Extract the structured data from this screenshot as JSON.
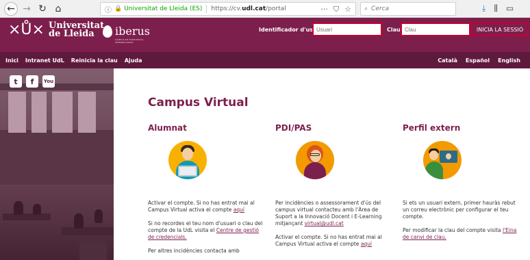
{
  "browser": {
    "url_org": "Universitat de Lleida (ES)",
    "url_text_prefix": "https://cv.",
    "url_text_domain": "udl.cat",
    "url_text_suffix": "/portal",
    "search_placeholder": "Cerca",
    "menu_dots": "···"
  },
  "header": {
    "university_line1": "Universitat",
    "university_line2": "de Lleida",
    "partner": "iberus",
    "partner_sub": "CAMPUS DE EXCELENCIA INTERNACIONAL",
    "login": {
      "user_label": "Identificador d'usuari",
      "user_placeholder": "Usuari",
      "pass_label": "Clau:",
      "pass_placeholder": "Clau",
      "submit_label": "INICIA LA SESSIÓ"
    }
  },
  "nav": {
    "left": [
      "Inici",
      "Intranet UdL",
      "Reinicia la clau",
      "Ajuda"
    ],
    "right": [
      "Català",
      "Español",
      "English"
    ]
  },
  "social": [
    "twitter-icon",
    "facebook-icon",
    "youtube-icon"
  ],
  "main": {
    "title": "Campus Virtual",
    "alumnat": {
      "heading": "Alumnat",
      "p1_text": "Activar el compte. Si no has entrat mai al Campus Virtual activa el compte ",
      "p1_link": "aquí",
      "p2_text": "Si no recordes el teu nom d'usuari o clau del compte de la UdL visita el ",
      "p2_link": "Centre de gestió de credencials.",
      "p3_text": "Per altres incidències contacta amb"
    },
    "pdi": {
      "heading": "PDI/PAS",
      "p1_text": "Per incidències o assessorament d'ús del campus virtual contacteu amb l'Àrea de Suport a la Innovació Docent i E-Learning mitjançant ",
      "p1_link": "virtual@udl.cat",
      "p2_text": "Activar el compte. Si no has entrat mai al Campus Virtual activa el compte ",
      "p2_link": "aquí"
    },
    "extern": {
      "heading": "Perfil extern",
      "p1_text": "Si ets un usuari extern, primer hauràs rebut un correu electrònic per configurar el teu compte.",
      "p2_text": "Per modificar la clau del compte visita ",
      "p2_link": "l'Eina de canvi de clau."
    }
  }
}
